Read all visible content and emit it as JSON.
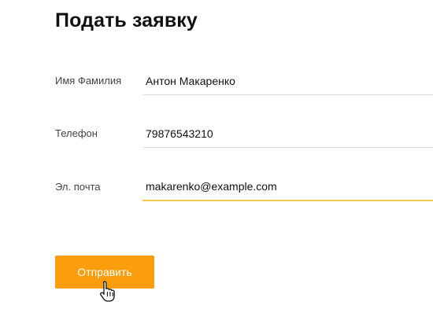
{
  "form": {
    "title": "Подать заявку",
    "fields": {
      "name": {
        "label": "Имя Фамилия",
        "value": "Антон Макаренко"
      },
      "phone": {
        "label": "Телефон",
        "value": "79876543210"
      },
      "email": {
        "label": "Эл. почта",
        "value": "makarenko@example.com"
      }
    },
    "submit_label": "Отправить"
  },
  "colors": {
    "accent": "#fb9d0c",
    "focus_underline": "#f2c94c",
    "field_underline": "#dcdcdc"
  },
  "cursor": {
    "icon": "hand-pointer-icon"
  }
}
